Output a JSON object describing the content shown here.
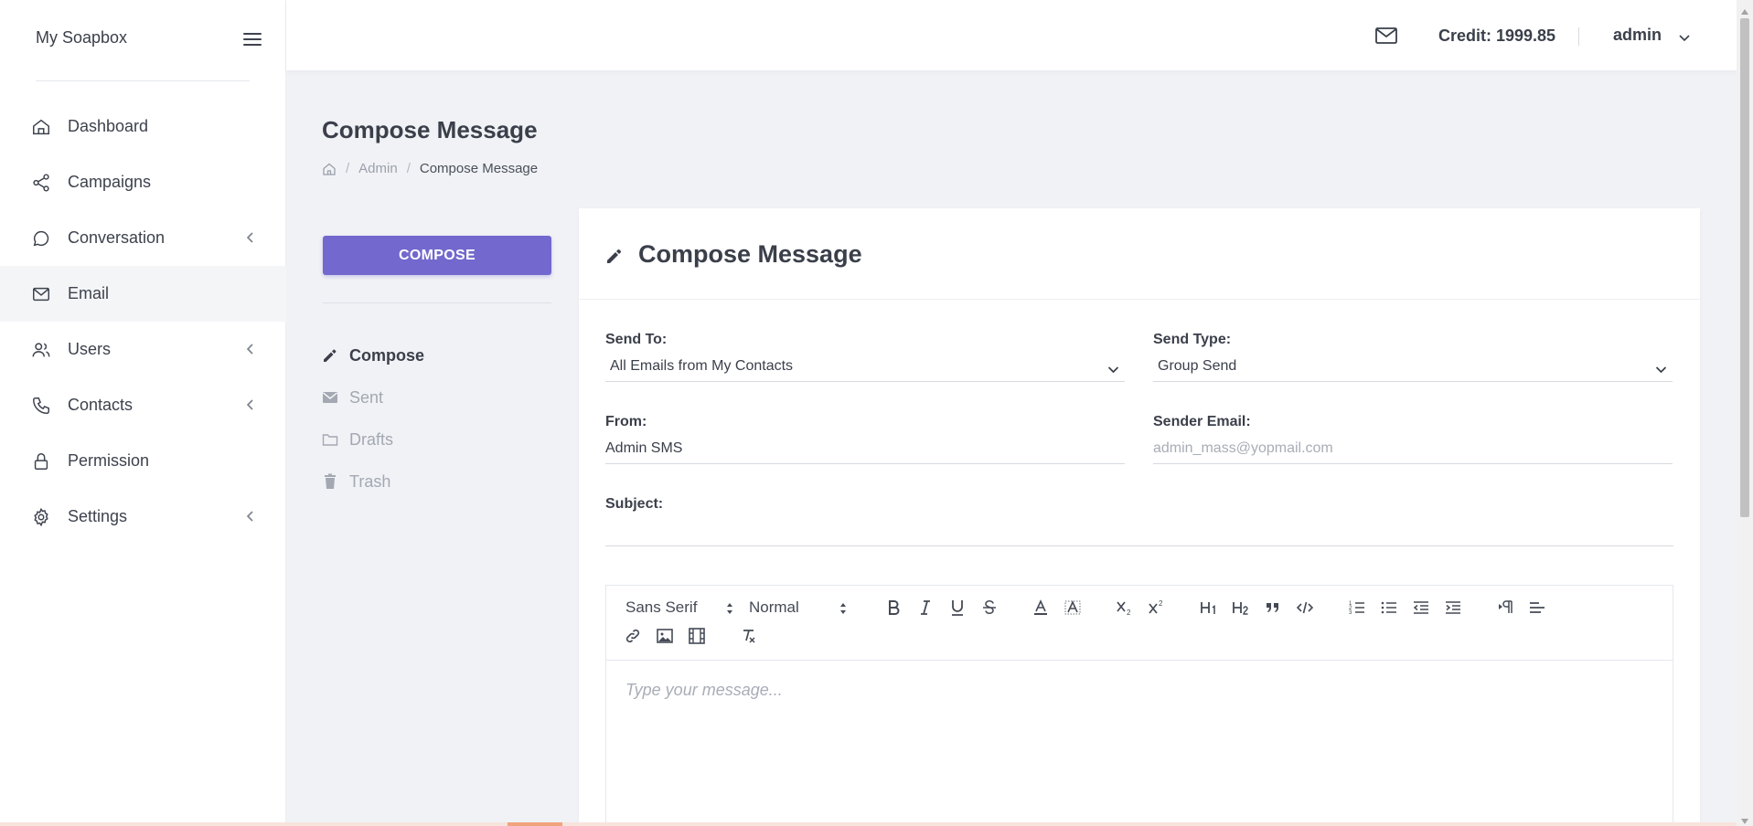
{
  "sidebar": {
    "brand": "My Soapbox",
    "items": [
      {
        "label": "Dashboard",
        "icon": "home-icon",
        "has_submenu": false
      },
      {
        "label": "Campaigns",
        "icon": "share-icon",
        "has_submenu": false
      },
      {
        "label": "Conversation",
        "icon": "chat-bubble-icon",
        "has_submenu": true
      },
      {
        "label": "Email",
        "icon": "envelope-icon",
        "has_submenu": false,
        "active": true
      },
      {
        "label": "Users",
        "icon": "users-icon",
        "has_submenu": true
      },
      {
        "label": "Contacts",
        "icon": "phone-icon",
        "has_submenu": true
      },
      {
        "label": "Permission",
        "icon": "lock-icon",
        "has_submenu": false
      },
      {
        "label": "Settings",
        "icon": "gear-icon",
        "has_submenu": true
      }
    ]
  },
  "topbar": {
    "credit": "Credit: 1999.85",
    "user": "admin"
  },
  "page": {
    "title": "Compose Message",
    "breadcrumb": [
      "Admin",
      "Compose Message"
    ]
  },
  "mail_menu": {
    "compose_button": "COMPOSE",
    "items": [
      {
        "label": "Compose",
        "icon": "pencil-icon",
        "active": true
      },
      {
        "label": "Sent",
        "icon": "envelope-icon"
      },
      {
        "label": "Drafts",
        "icon": "folder-icon"
      },
      {
        "label": "Trash",
        "icon": "trash-icon"
      }
    ]
  },
  "compose": {
    "title": "Compose Message",
    "send_to": {
      "label": "Send To:",
      "value": "All Emails from My Contacts"
    },
    "send_type": {
      "label": "Send Type:",
      "value": "Group Send"
    },
    "from": {
      "label": "From:",
      "value": "Admin SMS"
    },
    "sender_email": {
      "label": "Sender Email:",
      "placeholder": "admin_mass@yopmail.com"
    },
    "subject": {
      "label": "Subject:",
      "value": ""
    },
    "editor": {
      "font": "Sans Serif",
      "size": "Normal",
      "placeholder": "Type your message..."
    }
  },
  "colors": {
    "accent": "#7268cd",
    "background": "#f1f2f6"
  }
}
